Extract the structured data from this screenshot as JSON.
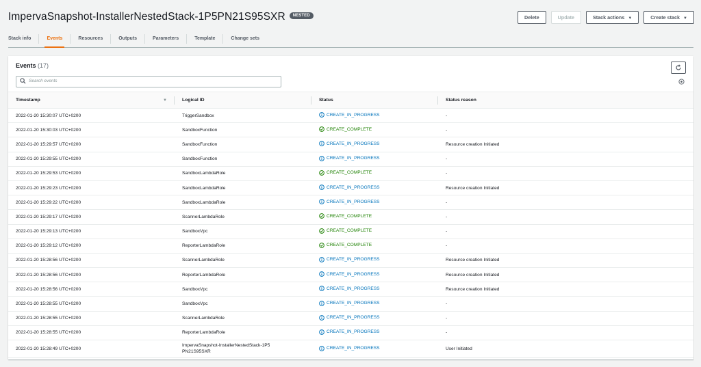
{
  "header": {
    "title": "ImpervaSnapshot-InstallerNestedStack-1P5PN21S95SXR",
    "badge": "NESTED",
    "buttons": {
      "delete": "Delete",
      "update": "Update",
      "stack_actions": "Stack actions",
      "create_stack": "Create stack"
    }
  },
  "tabs": [
    "Stack info",
    "Events",
    "Resources",
    "Outputs",
    "Parameters",
    "Template",
    "Change sets"
  ],
  "active_tab": "Events",
  "events": {
    "title": "Events",
    "count": "(17)",
    "search_placeholder": "Search events",
    "columns": [
      "Timestamp",
      "Logical ID",
      "Status",
      "Status reason"
    ],
    "rows": [
      {
        "timestamp": "2022-01-20 15:30:07 UTC+0200",
        "logical_id": "TriggerSandbox",
        "status": "CREATE_IN_PROGRESS",
        "reason": "-"
      },
      {
        "timestamp": "2022-01-20 15:30:03 UTC+0200",
        "logical_id": "SandboxFunction",
        "status": "CREATE_COMPLETE",
        "reason": "-"
      },
      {
        "timestamp": "2022-01-20 15:29:57 UTC+0200",
        "logical_id": "SandboxFunction",
        "status": "CREATE_IN_PROGRESS",
        "reason": "Resource creation Initiated"
      },
      {
        "timestamp": "2022-01-20 15:29:55 UTC+0200",
        "logical_id": "SandboxFunction",
        "status": "CREATE_IN_PROGRESS",
        "reason": "-"
      },
      {
        "timestamp": "2022-01-20 15:29:53 UTC+0200",
        "logical_id": "SandboxLambdaRole",
        "status": "CREATE_COMPLETE",
        "reason": "-"
      },
      {
        "timestamp": "2022-01-20 15:29:23 UTC+0200",
        "logical_id": "SandboxLambdaRole",
        "status": "CREATE_IN_PROGRESS",
        "reason": "Resource creation Initiated"
      },
      {
        "timestamp": "2022-01-20 15:29:22 UTC+0200",
        "logical_id": "SandboxLambdaRole",
        "status": "CREATE_IN_PROGRESS",
        "reason": "-"
      },
      {
        "timestamp": "2022-01-20 15:29:17 UTC+0200",
        "logical_id": "ScannerLambdaRole",
        "status": "CREATE_COMPLETE",
        "reason": "-"
      },
      {
        "timestamp": "2022-01-20 15:29:13 UTC+0200",
        "logical_id": "SandboxVpc",
        "status": "CREATE_COMPLETE",
        "reason": "-"
      },
      {
        "timestamp": "2022-01-20 15:29:12 UTC+0200",
        "logical_id": "ReporterLambdaRole",
        "status": "CREATE_COMPLETE",
        "reason": "-"
      },
      {
        "timestamp": "2022-01-20 15:28:56 UTC+0200",
        "logical_id": "ScannerLambdaRole",
        "status": "CREATE_IN_PROGRESS",
        "reason": "Resource creation Initiated"
      },
      {
        "timestamp": "2022-01-20 15:28:56 UTC+0200",
        "logical_id": "ReporterLambdaRole",
        "status": "CREATE_IN_PROGRESS",
        "reason": "Resource creation Initiated"
      },
      {
        "timestamp": "2022-01-20 15:28:56 UTC+0200",
        "logical_id": "SandboxVpc",
        "status": "CREATE_IN_PROGRESS",
        "reason": "Resource creation Initiated"
      },
      {
        "timestamp": "2022-01-20 15:28:55 UTC+0200",
        "logical_id": "SandboxVpc",
        "status": "CREATE_IN_PROGRESS",
        "reason": "-"
      },
      {
        "timestamp": "2022-01-20 15:28:55 UTC+0200",
        "logical_id": "ScannerLambdaRole",
        "status": "CREATE_IN_PROGRESS",
        "reason": "-"
      },
      {
        "timestamp": "2022-01-20 15:28:55 UTC+0200",
        "logical_id": "ReporterLambdaRole",
        "status": "CREATE_IN_PROGRESS",
        "reason": "-"
      },
      {
        "timestamp": "2022-01-20 15:28:49 UTC+0200",
        "logical_id": "ImpervaSnapshot-InstallerNestedStack-1P5PN21S95SXR",
        "status": "CREATE_IN_PROGRESS",
        "reason": "User Initiated"
      }
    ]
  },
  "colors": {
    "accent": "#ec7211",
    "in_progress": "#0073bb",
    "complete": "#1d8102"
  },
  "icons": {
    "search": "search-icon",
    "refresh": "refresh-icon",
    "settings": "gear-icon",
    "in_progress": "info-circle-icon",
    "complete": "check-circle-icon",
    "sort": "sort-down-icon"
  }
}
